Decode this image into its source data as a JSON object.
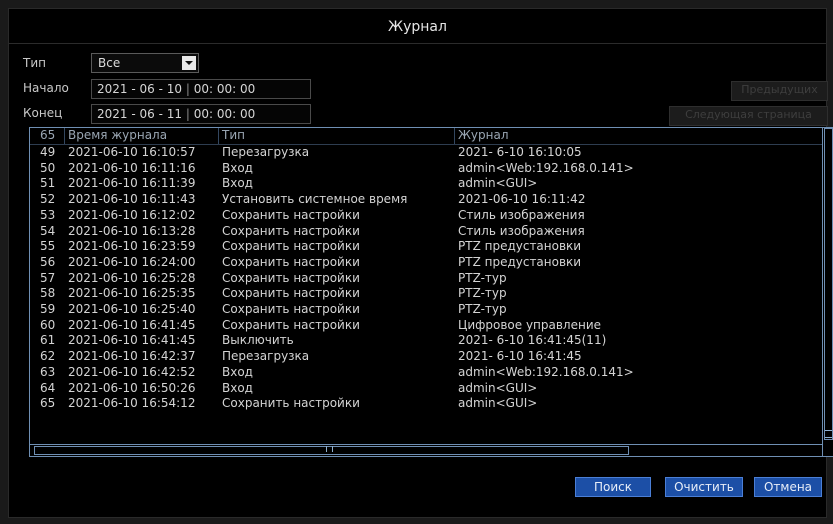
{
  "window": {
    "title": "Журнал"
  },
  "filters": {
    "type_label": "Тип",
    "type_value": "Все",
    "start_label": "Начало",
    "start_date": "2021 - 06 - 10",
    "start_time": "00: 00: 00",
    "end_label": "Конец",
    "end_date": "2021 - 06 - 11",
    "end_time": "00: 00: 00",
    "prev_label": "Предыдущих",
    "next_label": "Следующая страница"
  },
  "table": {
    "headers": {
      "num": "65",
      "time": "Время журнала",
      "type": "Тип",
      "log": "Журнал"
    },
    "rows": [
      {
        "num": "49",
        "time": "2021-06-10 16:10:57",
        "type": "Перезагрузка",
        "log": "2021- 6-10 16:10:05"
      },
      {
        "num": "50",
        "time": "2021-06-10 16:11:16",
        "type": "Вход",
        "log": "admin<Web:192.168.0.141>"
      },
      {
        "num": "51",
        "time": "2021-06-10 16:11:39",
        "type": "Вход",
        "log": "admin<GUI>"
      },
      {
        "num": "52",
        "time": "2021-06-10 16:11:43",
        "type": "Установить системное время",
        "log": "2021-06-10 16:11:42"
      },
      {
        "num": "53",
        "time": "2021-06-10 16:12:02",
        "type": "Сохранить настройки",
        "log": "Стиль изображения"
      },
      {
        "num": "54",
        "time": "2021-06-10 16:13:28",
        "type": "Сохранить настройки",
        "log": "Стиль изображения"
      },
      {
        "num": "55",
        "time": "2021-06-10 16:23:59",
        "type": "Сохранить настройки",
        "log": "PTZ предустановки"
      },
      {
        "num": "56",
        "time": "2021-06-10 16:24:00",
        "type": "Сохранить настройки",
        "log": "PTZ предустановки"
      },
      {
        "num": "57",
        "time": "2021-06-10 16:25:28",
        "type": "Сохранить настройки",
        "log": "PTZ-тур"
      },
      {
        "num": "58",
        "time": "2021-06-10 16:25:35",
        "type": "Сохранить настройки",
        "log": "PTZ-тур"
      },
      {
        "num": "59",
        "time": "2021-06-10 16:25:40",
        "type": "Сохранить настройки",
        "log": "PTZ-тур"
      },
      {
        "num": "60",
        "time": "2021-06-10 16:41:45",
        "type": "Сохранить настройки",
        "log": "Цифровое управление"
      },
      {
        "num": "61",
        "time": "2021-06-10 16:41:45",
        "type": "Выключить",
        "log": "2021- 6-10 16:41:45(11)"
      },
      {
        "num": "62",
        "time": "2021-06-10 16:42:37",
        "type": "Перезагрузка",
        "log": "2021- 6-10 16:41:45"
      },
      {
        "num": "63",
        "time": "2021-06-10 16:42:52",
        "type": "Вход",
        "log": "admin<Web:192.168.0.141>"
      },
      {
        "num": "64",
        "time": "2021-06-10 16:50:26",
        "type": "Вход",
        "log": "admin<GUI>"
      },
      {
        "num": "65",
        "time": "2021-06-10 16:54:12",
        "type": "Сохранить настройки",
        "log": "admin<GUI>"
      }
    ]
  },
  "buttons": {
    "search": "Поиск",
    "clear": "Очистить",
    "cancel": "Отмена"
  },
  "colors": {
    "accent": "#1c4fa6",
    "border": "#6f8fb3"
  }
}
